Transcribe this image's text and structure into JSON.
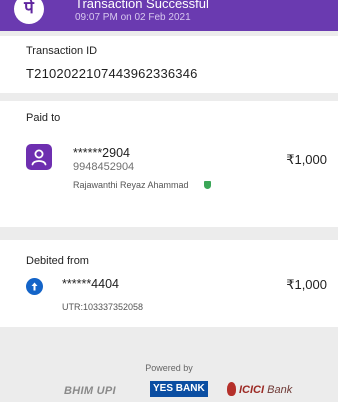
{
  "header": {
    "logo_char": "पे",
    "title": "Transaction Successful",
    "time": "09:07 PM on 02 Feb 2021"
  },
  "transaction": {
    "label": "Transaction ID",
    "id": "T2102022107443962336346"
  },
  "paid_to": {
    "label": "Paid to",
    "masked_account": "******2904",
    "phone": "9948452904",
    "name": "Rajawanthi Reyaz Ahammad",
    "amount": "₹1,000"
  },
  "debited_from": {
    "label": "Debited from",
    "masked_account": "******4404",
    "utr": "UTR:103337352058",
    "amount": "₹1,000"
  },
  "footer": {
    "powered_by": "Powered by",
    "bhim_upi": "BHIM UPI",
    "yes_bank": "YES BANK",
    "icici": "ICICI",
    "icici_bank": "Bank"
  },
  "colors": {
    "header": "#6a3ab0",
    "avatar": "#6e2fb0",
    "bank_icon": "#1464c8",
    "verified": "#3aa657"
  }
}
